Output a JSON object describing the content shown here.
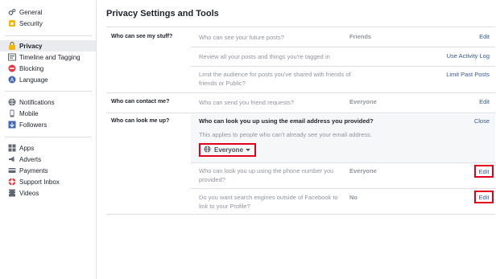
{
  "sidebar": {
    "items": [
      {
        "label": "General",
        "icon": "gear-icon"
      },
      {
        "label": "Security",
        "icon": "lock-icon"
      },
      {
        "label": "Privacy",
        "icon": "privacy-lock-icon",
        "active": true
      },
      {
        "label": "Timeline and Tagging",
        "icon": "timeline-icon"
      },
      {
        "label": "Blocking",
        "icon": "blocking-icon"
      },
      {
        "label": "Language",
        "icon": "language-icon"
      },
      {
        "label": "Notifications",
        "icon": "globe-icon"
      },
      {
        "label": "Mobile",
        "icon": "mobile-icon"
      },
      {
        "label": "Followers",
        "icon": "followers-icon"
      },
      {
        "label": "Apps",
        "icon": "apps-icon"
      },
      {
        "label": "Adverts",
        "icon": "adverts-icon"
      },
      {
        "label": "Payments",
        "icon": "payments-icon"
      },
      {
        "label": "Support Inbox",
        "icon": "support-inbox-icon"
      },
      {
        "label": "Videos",
        "icon": "videos-icon"
      }
    ]
  },
  "main": {
    "title": "Privacy Settings and Tools",
    "sections": [
      {
        "category": "Who can see my stuff?",
        "rows": [
          {
            "question": "Who can see your future posts?",
            "value": "Friends",
            "action": "Edit"
          },
          {
            "question": "Review all your posts and things you're tagged in",
            "value": "",
            "action": "Use Activity Log"
          },
          {
            "question": "Limit the audience for posts you've shared with friends of friends or Public?",
            "value": "",
            "action": "Limit Past Posts"
          }
        ]
      },
      {
        "category": "Who can contact me?",
        "rows": [
          {
            "question": "Who can send you friend requests?",
            "value": "Everyone",
            "action": "Edit"
          }
        ]
      },
      {
        "category": "Who can look me up?",
        "expanded": {
          "question": "Who can look you up using the email address you provided?",
          "note": "This applies to people who can't already see your email address.",
          "audience": "Everyone",
          "close": "Close"
        },
        "rows": [
          {
            "question": "Who can look you up using the phone number you provided?",
            "value": "Everyone",
            "action": "Edit"
          },
          {
            "question": "Do you want search engines outside of Facebook to link to your Profile?",
            "value": "No",
            "action": "Edit"
          }
        ]
      }
    ]
  },
  "colors": {
    "link": "#365899",
    "highlight": "#e0001b",
    "muted": "#90949c",
    "active_bg": "#e9ebee"
  }
}
